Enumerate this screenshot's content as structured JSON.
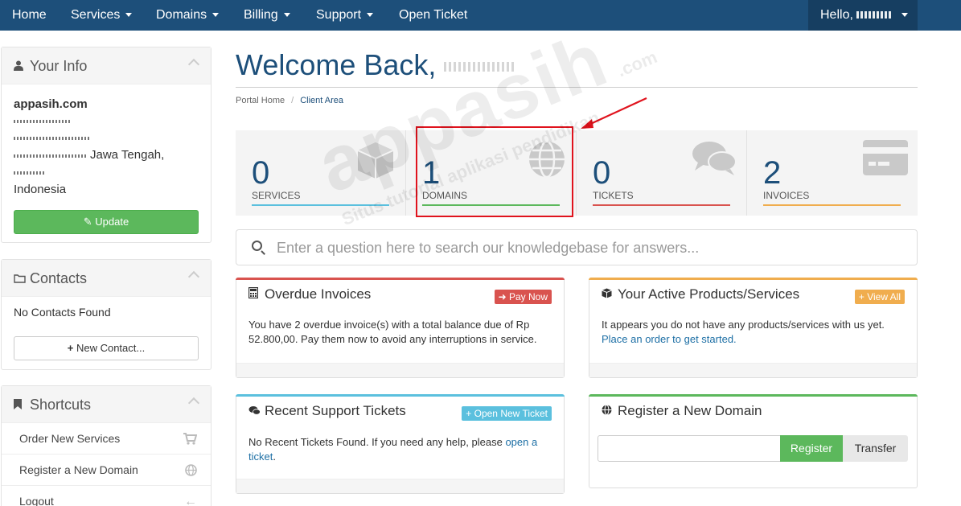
{
  "nav": {
    "items": [
      {
        "label": "Home",
        "has_caret": false
      },
      {
        "label": "Services",
        "has_caret": true
      },
      {
        "label": "Domains",
        "has_caret": true
      },
      {
        "label": "Billing",
        "has_caret": true
      },
      {
        "label": "Support",
        "has_caret": true
      },
      {
        "label": "Open Ticket",
        "has_caret": false
      }
    ],
    "hello_label": "Hello,"
  },
  "sidebar": {
    "your_info": {
      "title": "Your Info",
      "company": "appasih.com",
      "address_partial": "Jawa Tengah,",
      "country": "Indonesia",
      "update_label": "Update"
    },
    "contacts": {
      "title": "Contacts",
      "empty_text": "No Contacts Found",
      "new_contact_label": "New Contact..."
    },
    "shortcuts": {
      "title": "Shortcuts",
      "items": [
        {
          "label": "Order New Services",
          "icon": "shopping-cart-icon"
        },
        {
          "label": "Register a New Domain",
          "icon": "globe-icon"
        },
        {
          "label": "Logout",
          "icon": "arrow-left-icon"
        }
      ]
    }
  },
  "main": {
    "title": "Welcome Back,",
    "breadcrumb": {
      "home": "Portal Home",
      "separator": "/",
      "current": "Client Area"
    },
    "tiles": [
      {
        "count": "0",
        "label": "SERVICES",
        "icon": "cube-icon",
        "color": "#5bc0de"
      },
      {
        "count": "1",
        "label": "DOMAINS",
        "icon": "globe-icon",
        "color": "#5cb85c"
      },
      {
        "count": "0",
        "label": "TICKETS",
        "icon": "comments-icon",
        "color": "#d9534f"
      },
      {
        "count": "2",
        "label": "INVOICES",
        "icon": "credit-card-icon",
        "color": "#f0ad4e"
      }
    ],
    "search": {
      "placeholder": "Enter a question here to search our knowledgebase for answers..."
    },
    "cards": {
      "overdue": {
        "title": "Overdue Invoices",
        "button": "Pay Now",
        "body": "You have 2 overdue invoice(s) with a total balance due of Rp 52.800,00. Pay them now to avoid any interruptions in service."
      },
      "products": {
        "title": "Your Active Products/Services",
        "button": "View All",
        "body": "It appears you do not have any products/services with us yet.",
        "link": "Place an order to get started."
      },
      "tickets": {
        "title": "Recent Support Tickets",
        "button": "Open New Ticket",
        "body": "No Recent Tickets Found. If you need any help, please",
        "link": "open a ticket",
        "suffix": "."
      },
      "domain": {
        "title": "Register a New Domain",
        "register_label": "Register",
        "transfer_label": "Transfer"
      }
    }
  },
  "watermark": {
    "brand": "appasih",
    "domain": ".com",
    "tagline": "Situs tutorial aplikasi pendidikan"
  },
  "colors": {
    "nav": "#1d4f7a",
    "accent": "#1d4f7a",
    "green": "#5cb85c",
    "red": "#d9534f",
    "orange": "#f0ad4e",
    "cyan": "#5bc0de",
    "annotation": "#e0131d"
  }
}
